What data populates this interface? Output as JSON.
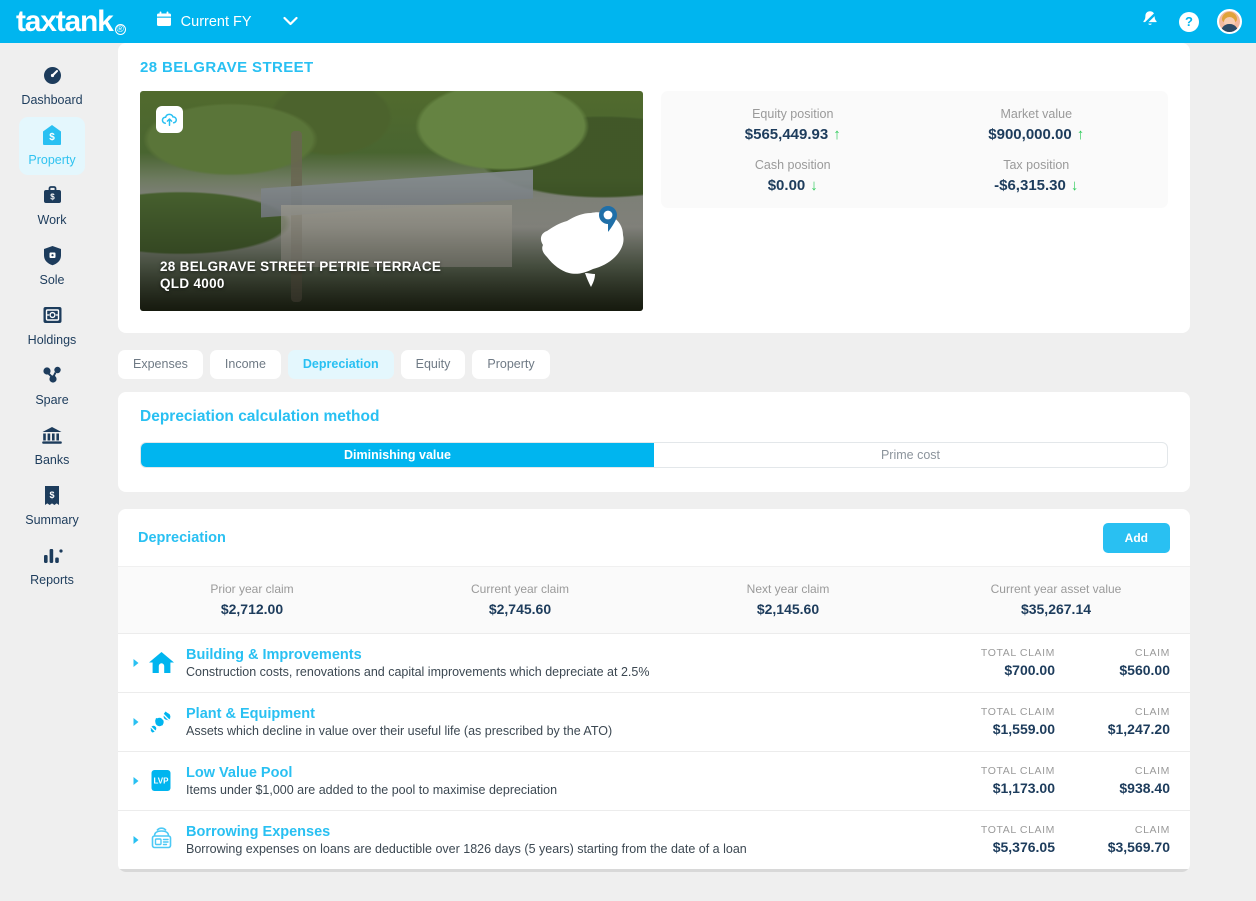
{
  "topbar": {
    "brand": "taxtank",
    "brand_mark": "®",
    "fy_label": "Current FY",
    "calendar_icon": "calendar-icon",
    "chevron_icon": "chevron-down-icon",
    "notifications_icon": "bell-muted-icon",
    "help_label": "?",
    "avatar_icon": "user-avatar"
  },
  "sidebar": {
    "items": [
      {
        "label": "Dashboard",
        "icon": "speedometer-icon",
        "active": false
      },
      {
        "label": "Property",
        "icon": "property-tag-icon",
        "active": true
      },
      {
        "label": "Work",
        "icon": "briefcase-icon",
        "active": false
      },
      {
        "label": "Sole",
        "icon": "shield-icon",
        "active": false
      },
      {
        "label": "Holdings",
        "icon": "safe-icon",
        "active": false
      },
      {
        "label": "Spare",
        "icon": "share-nodes-icon",
        "active": false
      },
      {
        "label": "Banks",
        "icon": "bank-icon",
        "active": false
      },
      {
        "label": "Summary",
        "icon": "receipt-dollar-icon",
        "active": false
      },
      {
        "label": "Reports",
        "icon": "bar-chart-icon",
        "active": false
      }
    ]
  },
  "property": {
    "title": "28 BELGRAVE STREET",
    "photo_caption_line1": "28 BELGRAVE STREET PETRIE TERRACE",
    "photo_caption_line2": "QLD 4000",
    "upload_icon": "cloud-upload-icon",
    "map_icon": "australia-map-pin-icon",
    "stats": [
      {
        "label": "Equity position",
        "value": "$565,449.93",
        "trend": "↑",
        "trend_color": "#2ecb5a"
      },
      {
        "label": "Market value",
        "value": "$900,000.00",
        "trend": "↑",
        "trend_color": "#2ecb5a"
      },
      {
        "label": "Cash position",
        "value": "$0.00",
        "trend": "↓",
        "trend_color": "#2ecb5a"
      },
      {
        "label": "Tax position",
        "value": "-$6,315.30",
        "trend": "↓",
        "trend_color": "#2ecb5a"
      }
    ]
  },
  "tabs": [
    {
      "label": "Expenses",
      "active": false
    },
    {
      "label": "Income",
      "active": false
    },
    {
      "label": "Depreciation",
      "active": true
    },
    {
      "label": "Equity",
      "active": false
    },
    {
      "label": "Property",
      "active": false
    }
  ],
  "method": {
    "title": "Depreciation calculation method",
    "options": [
      {
        "label": "Diminishing value",
        "active": true
      },
      {
        "label": "Prime cost",
        "active": false
      }
    ]
  },
  "depreciation": {
    "title": "Depreciation",
    "add_label": "Add",
    "summary": [
      {
        "label": "Prior year claim",
        "value": "$2,712.00"
      },
      {
        "label": "Current year claim",
        "value": "$2,745.60"
      },
      {
        "label": "Next year claim",
        "value": "$2,145.60"
      },
      {
        "label": "Current year asset value",
        "value": "$35,267.14"
      }
    ],
    "total_claim_label": "TOTAL CLAIM",
    "claim_label": "CLAIM",
    "rows": [
      {
        "icon": "house-icon",
        "name": "Building & Improvements",
        "desc": "Construction costs, renovations and capital improvements which depreciate at 2.5%",
        "total_claim": "$700.00",
        "claim": "$560.00"
      },
      {
        "icon": "gears-icon",
        "name": "Plant & Equipment",
        "desc": "Assets which decline in value over their useful life (as prescribed by the ATO)",
        "total_claim": "$1,559.00",
        "claim": "$1,247.20"
      },
      {
        "icon": "lvp-badge-icon",
        "name": "Low Value Pool",
        "desc": "Items under $1,000 are added to the pool to maximise depreciation",
        "total_claim": "$1,173.00",
        "claim": "$938.40"
      },
      {
        "icon": "money-bag-icon",
        "name": "Borrowing Expenses",
        "desc": "Borrowing expenses on loans are deductible over 1826 days (5 years) starting from the date of a loan",
        "total_claim": "$5,376.05",
        "claim": "$3,569.70"
      }
    ]
  },
  "colors": {
    "accent": "#00b5ef",
    "accent_light": "#29c0f2",
    "navy": "#1d3c5c",
    "green": "#2ecb5a",
    "page_bg": "#efefef"
  }
}
